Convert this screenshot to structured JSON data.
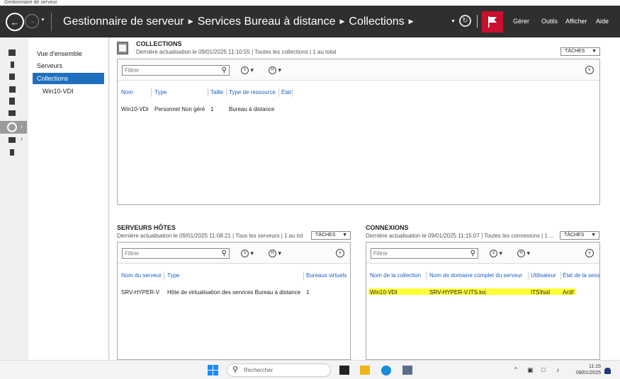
{
  "window": {
    "title": "Gestionnaire de serveur"
  },
  "header": {
    "breadcrumb": [
      "Gestionnaire de serveur",
      "Services Bureau à distance",
      "Collections"
    ],
    "menu": [
      "Gérer",
      "Outils",
      "Afficher",
      "Aide"
    ],
    "flag_color": "#c8102e"
  },
  "leftrail": {
    "icons": [
      "dashboard-icon",
      "local-server-icon",
      "all-servers-icon",
      "file-services-icon",
      "hyperv-icon",
      "iis-icon",
      "remote-desktop-icon",
      "roles-icon",
      "tools-icon"
    ]
  },
  "nav": {
    "items": [
      "Vue d'ensemble",
      "Serveurs",
      "Collections",
      "Win10-VDI"
    ],
    "selected": "Collections",
    "selected_color": "#1f6fbf"
  },
  "collections": {
    "title": "COLLECTIONS",
    "subtitle": "Dernière actualisation le 09/01/2025 11:10:55 | Toutes les collections | 1 au total",
    "tasks_label": "TÂCHES",
    "filter_placeholder": "Filtrer",
    "columns": [
      "Nom",
      "Type",
      "Taille",
      "Type de ressource",
      "État"
    ],
    "rows": [
      {
        "name": "Win10-VDI",
        "type": "Personnel Non géré",
        "size": "1",
        "resource_type": "Bureau à distance",
        "state": ""
      }
    ]
  },
  "host_servers": {
    "title": "SERVEURS HÔTES",
    "subtitle": "Dernière actualisation le 09/01/2025 11:08:21 | Tous les serveurs | 1 au tot",
    "tasks_label": "TÂCHES",
    "filter_placeholder": "Filtrer",
    "columns": [
      "Nom du serveur",
      "Type",
      "Bureaux virtuels"
    ],
    "rows": [
      {
        "server": "SRV-HYPER-V",
        "type": "Hôte de virtualisation des services Bureau à distance",
        "vdesktops": "1"
      }
    ]
  },
  "connections": {
    "title": "CONNEXIONS",
    "subtitle": "Dernière actualisation le 09/01/2025 11:15:07 | Toutes les connexions | 1 ...",
    "tasks_label": "TÂCHES",
    "filter_placeholder": "Filtrer",
    "columns": [
      "Nom de la collection",
      "Nom de domaine complet du serveur",
      "Utilisateur",
      "État de la sessi"
    ],
    "rows": [
      {
        "collection": "Win10-VDI",
        "fqdn": "SRV-HYPER-V.ITS.loc",
        "user": "ITS\\fsid",
        "state": "Actif"
      }
    ],
    "highlight_color": "#ffff33"
  },
  "taskbar": {
    "search_placeholder": "Rechercher",
    "clock_time": "11:15",
    "clock_date": "09/01/2025"
  }
}
